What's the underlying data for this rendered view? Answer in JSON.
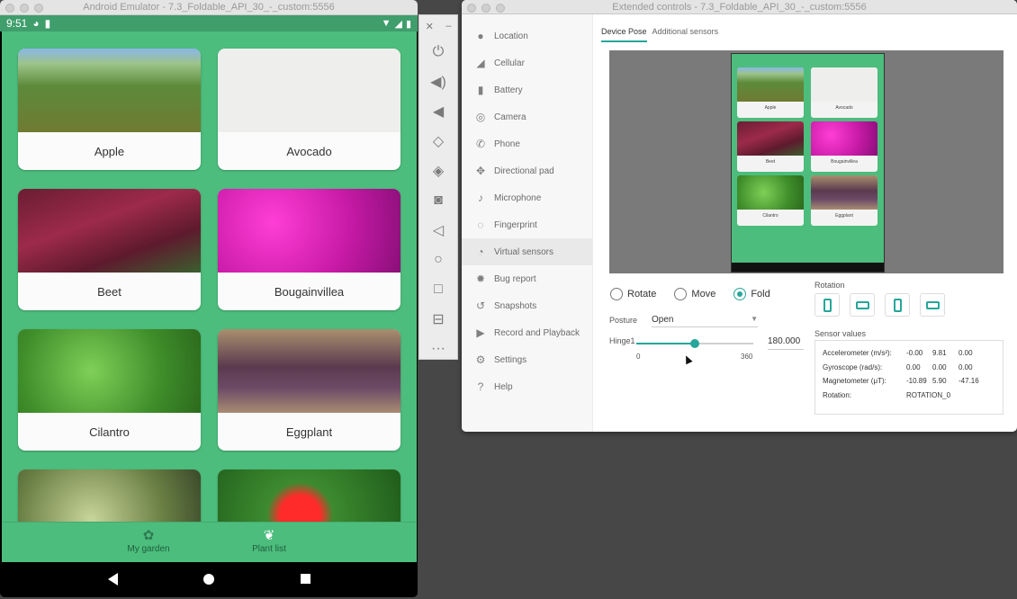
{
  "emulator": {
    "title": "Android Emulator - 7.3_Foldable_API_30_-_custom:5556",
    "status": {
      "time": "9:51"
    },
    "plants": [
      {
        "name": "Apple"
      },
      {
        "name": "Avocado"
      },
      {
        "name": "Beet"
      },
      {
        "name": "Bougainvillea"
      },
      {
        "name": "Cilantro"
      },
      {
        "name": "Eggplant"
      },
      {
        "name": ""
      },
      {
        "name": ""
      }
    ],
    "bottom_nav": {
      "my_garden": "My garden",
      "plant_list": "Plant list"
    }
  },
  "extended": {
    "title": "Extended controls - 7.3_Foldable_API_30_-_custom:5556",
    "menu": [
      {
        "label": "Location",
        "icon": "location-icon"
      },
      {
        "label": "Cellular",
        "icon": "cellular-icon"
      },
      {
        "label": "Battery",
        "icon": "battery-icon"
      },
      {
        "label": "Camera",
        "icon": "camera-icon"
      },
      {
        "label": "Phone",
        "icon": "phone-icon"
      },
      {
        "label": "Directional pad",
        "icon": "dpad-icon"
      },
      {
        "label": "Microphone",
        "icon": "microphone-icon"
      },
      {
        "label": "Fingerprint",
        "icon": "fingerprint-icon"
      },
      {
        "label": "Virtual sensors",
        "icon": "sensors-icon"
      },
      {
        "label": "Bug report",
        "icon": "bug-icon"
      },
      {
        "label": "Snapshots",
        "icon": "snapshots-icon"
      },
      {
        "label": "Record and Playback",
        "icon": "record-icon"
      },
      {
        "label": "Settings",
        "icon": "settings-icon"
      },
      {
        "label": "Help",
        "icon": "help-icon"
      }
    ],
    "tabs": {
      "device_pose": "Device Pose",
      "additional": "Additional sensors"
    },
    "pose": {
      "rotate": "Rotate",
      "move": "Move",
      "fold": "Fold",
      "selected": "Fold"
    },
    "posture": {
      "label": "Posture",
      "value": "Open"
    },
    "hinge": {
      "label": "Hinge1",
      "value": "180.000",
      "min": "0",
      "max": "360",
      "fraction": 0.5
    },
    "rotation": {
      "label": "Rotation"
    },
    "sensor_values": {
      "label": "Sensor values",
      "rows": [
        {
          "key": "Accelerometer (m/s²):",
          "v1": "-0.00",
          "v2": "9.81",
          "v3": "0.00"
        },
        {
          "key": "Gyroscope (rad/s):",
          "v1": "0.00",
          "v2": "0.00",
          "v3": "0.00"
        },
        {
          "key": "Magnetometer (μT):",
          "v1": "-10.89",
          "v2": "5.90",
          "v3": "-47.16"
        },
        {
          "key": "Rotation:",
          "v1": "ROTATION_0",
          "v2": "",
          "v3": ""
        }
      ]
    }
  },
  "toolbar": {
    "buttons": [
      "power-icon",
      "volume-up-icon",
      "volume-down-icon",
      "rotate-left-icon",
      "rotate-right-icon",
      "screenshot-icon",
      "back-icon",
      "home-icon",
      "overview-icon",
      "fold-icon",
      "more-icon"
    ]
  }
}
